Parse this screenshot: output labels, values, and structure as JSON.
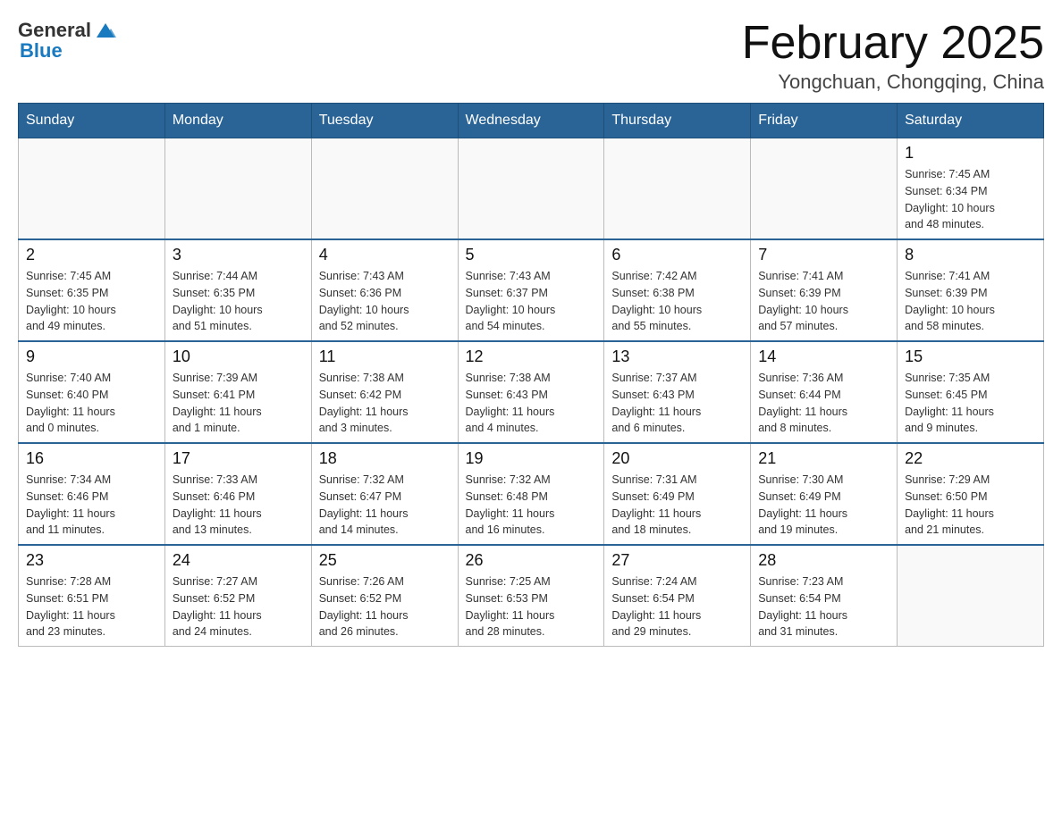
{
  "header": {
    "logo_general": "General",
    "logo_blue": "Blue",
    "month_title": "February 2025",
    "location": "Yongchuan, Chongqing, China"
  },
  "weekdays": [
    "Sunday",
    "Monday",
    "Tuesday",
    "Wednesday",
    "Thursday",
    "Friday",
    "Saturday"
  ],
  "weeks": [
    [
      {
        "day": "",
        "info": ""
      },
      {
        "day": "",
        "info": ""
      },
      {
        "day": "",
        "info": ""
      },
      {
        "day": "",
        "info": ""
      },
      {
        "day": "",
        "info": ""
      },
      {
        "day": "",
        "info": ""
      },
      {
        "day": "1",
        "info": "Sunrise: 7:45 AM\nSunset: 6:34 PM\nDaylight: 10 hours\nand 48 minutes."
      }
    ],
    [
      {
        "day": "2",
        "info": "Sunrise: 7:45 AM\nSunset: 6:35 PM\nDaylight: 10 hours\nand 49 minutes."
      },
      {
        "day": "3",
        "info": "Sunrise: 7:44 AM\nSunset: 6:35 PM\nDaylight: 10 hours\nand 51 minutes."
      },
      {
        "day": "4",
        "info": "Sunrise: 7:43 AM\nSunset: 6:36 PM\nDaylight: 10 hours\nand 52 minutes."
      },
      {
        "day": "5",
        "info": "Sunrise: 7:43 AM\nSunset: 6:37 PM\nDaylight: 10 hours\nand 54 minutes."
      },
      {
        "day": "6",
        "info": "Sunrise: 7:42 AM\nSunset: 6:38 PM\nDaylight: 10 hours\nand 55 minutes."
      },
      {
        "day": "7",
        "info": "Sunrise: 7:41 AM\nSunset: 6:39 PM\nDaylight: 10 hours\nand 57 minutes."
      },
      {
        "day": "8",
        "info": "Sunrise: 7:41 AM\nSunset: 6:39 PM\nDaylight: 10 hours\nand 58 minutes."
      }
    ],
    [
      {
        "day": "9",
        "info": "Sunrise: 7:40 AM\nSunset: 6:40 PM\nDaylight: 11 hours\nand 0 minutes."
      },
      {
        "day": "10",
        "info": "Sunrise: 7:39 AM\nSunset: 6:41 PM\nDaylight: 11 hours\nand 1 minute."
      },
      {
        "day": "11",
        "info": "Sunrise: 7:38 AM\nSunset: 6:42 PM\nDaylight: 11 hours\nand 3 minutes."
      },
      {
        "day": "12",
        "info": "Sunrise: 7:38 AM\nSunset: 6:43 PM\nDaylight: 11 hours\nand 4 minutes."
      },
      {
        "day": "13",
        "info": "Sunrise: 7:37 AM\nSunset: 6:43 PM\nDaylight: 11 hours\nand 6 minutes."
      },
      {
        "day": "14",
        "info": "Sunrise: 7:36 AM\nSunset: 6:44 PM\nDaylight: 11 hours\nand 8 minutes."
      },
      {
        "day": "15",
        "info": "Sunrise: 7:35 AM\nSunset: 6:45 PM\nDaylight: 11 hours\nand 9 minutes."
      }
    ],
    [
      {
        "day": "16",
        "info": "Sunrise: 7:34 AM\nSunset: 6:46 PM\nDaylight: 11 hours\nand 11 minutes."
      },
      {
        "day": "17",
        "info": "Sunrise: 7:33 AM\nSunset: 6:46 PM\nDaylight: 11 hours\nand 13 minutes."
      },
      {
        "day": "18",
        "info": "Sunrise: 7:32 AM\nSunset: 6:47 PM\nDaylight: 11 hours\nand 14 minutes."
      },
      {
        "day": "19",
        "info": "Sunrise: 7:32 AM\nSunset: 6:48 PM\nDaylight: 11 hours\nand 16 minutes."
      },
      {
        "day": "20",
        "info": "Sunrise: 7:31 AM\nSunset: 6:49 PM\nDaylight: 11 hours\nand 18 minutes."
      },
      {
        "day": "21",
        "info": "Sunrise: 7:30 AM\nSunset: 6:49 PM\nDaylight: 11 hours\nand 19 minutes."
      },
      {
        "day": "22",
        "info": "Sunrise: 7:29 AM\nSunset: 6:50 PM\nDaylight: 11 hours\nand 21 minutes."
      }
    ],
    [
      {
        "day": "23",
        "info": "Sunrise: 7:28 AM\nSunset: 6:51 PM\nDaylight: 11 hours\nand 23 minutes."
      },
      {
        "day": "24",
        "info": "Sunrise: 7:27 AM\nSunset: 6:52 PM\nDaylight: 11 hours\nand 24 minutes."
      },
      {
        "day": "25",
        "info": "Sunrise: 7:26 AM\nSunset: 6:52 PM\nDaylight: 11 hours\nand 26 minutes."
      },
      {
        "day": "26",
        "info": "Sunrise: 7:25 AM\nSunset: 6:53 PM\nDaylight: 11 hours\nand 28 minutes."
      },
      {
        "day": "27",
        "info": "Sunrise: 7:24 AM\nSunset: 6:54 PM\nDaylight: 11 hours\nand 29 minutes."
      },
      {
        "day": "28",
        "info": "Sunrise: 7:23 AM\nSunset: 6:54 PM\nDaylight: 11 hours\nand 31 minutes."
      },
      {
        "day": "",
        "info": ""
      }
    ]
  ]
}
